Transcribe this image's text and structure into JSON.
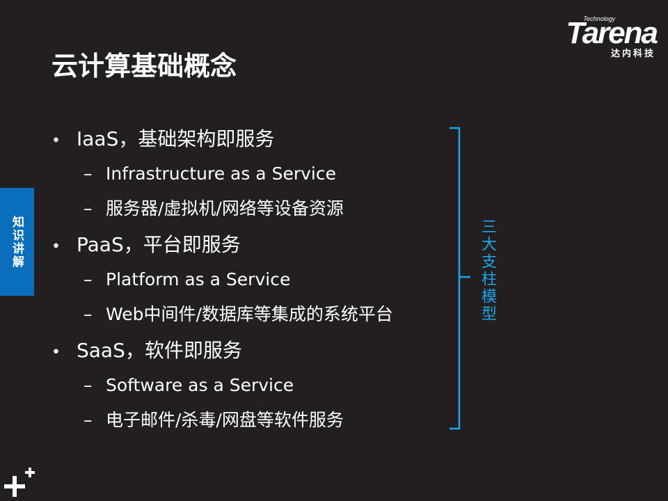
{
  "logo": {
    "small": "Technology",
    "word": "Tarena",
    "cn": "达内科技"
  },
  "title": "云计算基础概念",
  "side_tab": "知识讲解",
  "bullets": [
    {
      "text": "IaaS，基础架构即服务",
      "subs": [
        "Infrastructure as a Service",
        "服务器/虚拟机/网络等设备资源"
      ]
    },
    {
      "text": "PaaS，平台即服务",
      "subs": [
        "Platform as a Service",
        "Web中间件/数据库等集成的系统平台"
      ]
    },
    {
      "text": "SaaS，软件即服务",
      "subs": [
        "Software as a Service",
        "电子邮件/杀毒/网盘等软件服务"
      ]
    }
  ],
  "bracket_label": "三大支柱模型",
  "colors": {
    "background": "#231f20",
    "accent_blue": "#0a6ebd",
    "label_blue": "#1aa8e8"
  }
}
